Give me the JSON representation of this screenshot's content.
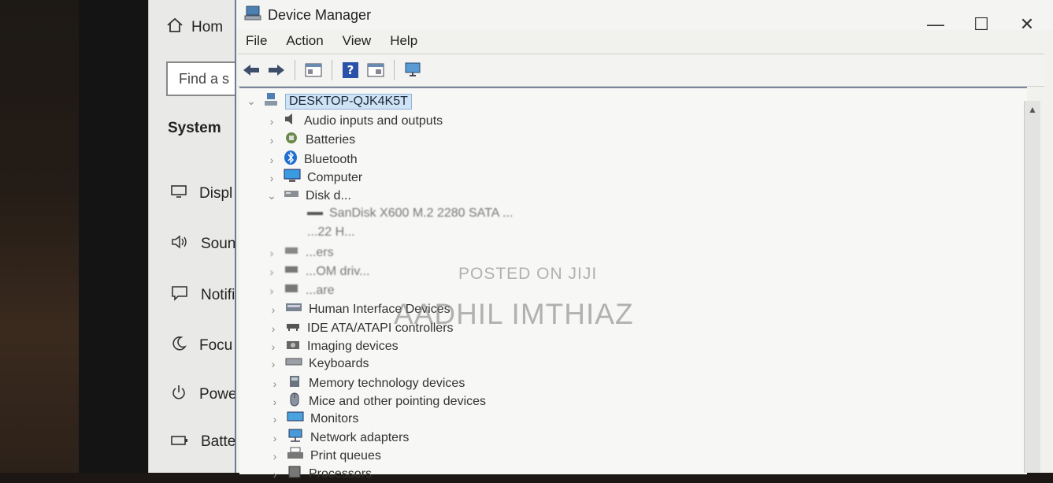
{
  "settings": {
    "home_label": "Hom",
    "search_placeholder": "Find a s",
    "section_title": "System",
    "items": [
      {
        "label": "Displ",
        "icon": "display-icon"
      },
      {
        "label": "Soun",
        "icon": "sound-icon"
      },
      {
        "label": "Notifi",
        "icon": "notification-icon"
      },
      {
        "label": "Focu",
        "icon": "focus-assist-icon"
      },
      {
        "label": "Powe",
        "icon": "power-icon"
      },
      {
        "label": "Batte",
        "icon": "battery-icon"
      }
    ]
  },
  "window": {
    "title": "Device Manager",
    "minimize": "—",
    "maximize": "☐",
    "close": "✕"
  },
  "menu": [
    "File",
    "Action",
    "View",
    "Help"
  ],
  "tree": {
    "root": "DESKTOP-QJK4K5T",
    "items": [
      {
        "label": "Audio inputs and outputs",
        "icon": "speaker-icon"
      },
      {
        "label": "Batteries",
        "icon": "battery-icon"
      },
      {
        "label": "Bluetooth",
        "icon": "bluetooth-icon"
      },
      {
        "label": "Computer",
        "icon": "computer-icon"
      },
      {
        "label": "Disk d...",
        "icon": "disk-drive-icon",
        "expanded": true
      },
      {
        "label": "SanDisk X600 M.2 2280 SATA ...",
        "icon": "drive-icon",
        "child": true,
        "blurred": true
      },
      {
        "label": "...22 H...",
        "icon": "drive-icon",
        "child": true,
        "blurred": true
      },
      {
        "label": "...ers",
        "icon": "adapter-icon",
        "blurred": true
      },
      {
        "label": "...OM driv...",
        "icon": "dvd-icon",
        "blurred": true
      },
      {
        "label": "...are",
        "icon": "firmware-icon",
        "blurred": true
      },
      {
        "label": "Human Interface Devices",
        "icon": "hid-icon"
      },
      {
        "label": "IDE ATA/ATAPI controllers",
        "icon": "ide-icon"
      },
      {
        "label": "Imaging devices",
        "icon": "camera-icon"
      },
      {
        "label": "Keyboards",
        "icon": "keyboard-icon"
      },
      {
        "label": "Memory technology devices",
        "icon": "memory-icon"
      },
      {
        "label": "Mice and other pointing devices",
        "icon": "mouse-icon"
      },
      {
        "label": "Monitors",
        "icon": "monitor-icon"
      },
      {
        "label": "Network adapters",
        "icon": "network-icon"
      },
      {
        "label": "Print queues",
        "icon": "printer-icon"
      },
      {
        "label": "Processors",
        "icon": "processor-icon"
      }
    ]
  },
  "watermark": {
    "line1": "POSTED ON JIJI",
    "line2": "AADHIL IMTHIAZ"
  }
}
